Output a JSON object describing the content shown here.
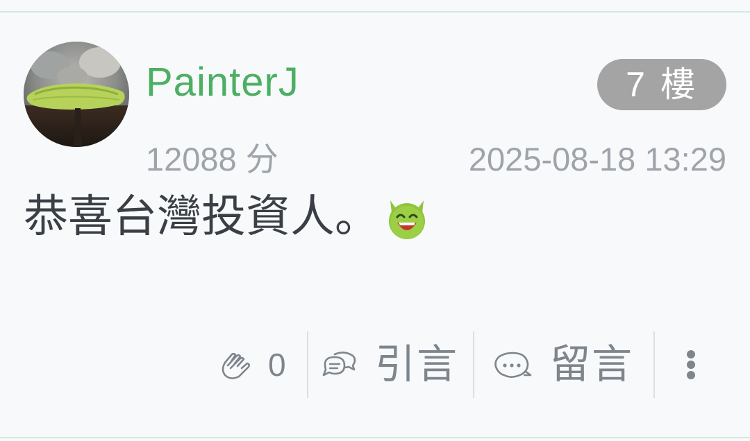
{
  "post": {
    "username": "PainterJ",
    "floor": "7 樓",
    "score": "12088 分",
    "timestamp": "2025-08-18 13:29",
    "content": "恭喜台灣投資人。",
    "emoji": "devil-laughing-emoji"
  },
  "actions": {
    "gp_count": "0",
    "quote_label": "引言",
    "comment_label": "留言"
  },
  "icons": {
    "gp": "clap-hands-icon",
    "quote": "chat-bubbles-icon",
    "comment": "comment-bubble-icon",
    "more": "more-vertical-icon"
  },
  "colors": {
    "username": "#4caf63",
    "badge_bg": "#a4a4a4",
    "meta_text": "#9ea4a9",
    "content_text": "#3a3f45",
    "action_text": "#7e858c",
    "divider": "#d3e9dc"
  }
}
